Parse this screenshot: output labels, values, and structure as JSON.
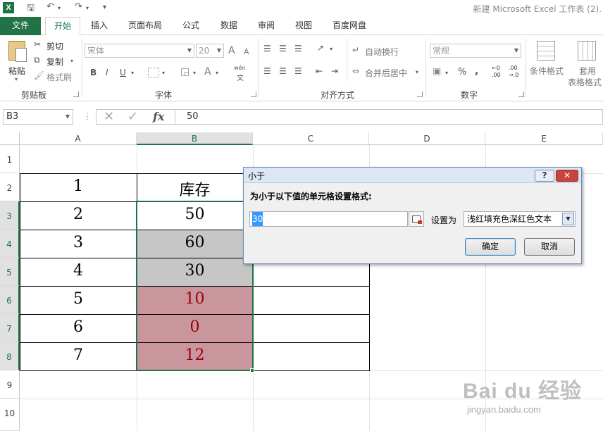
{
  "window": {
    "app_icon": "X",
    "title": "新建 Microsoft Excel 工作表 (2)."
  },
  "quick_access": {
    "save_icon": "save-icon",
    "undo_icon": "undo-icon",
    "redo_icon": "redo-icon",
    "customize_icon": "customize-icon"
  },
  "tabs": {
    "file": "文件",
    "home": "开始",
    "insert": "插入",
    "page_layout": "页面布局",
    "formulas": "公式",
    "data": "数据",
    "review": "审阅",
    "view": "视图",
    "baidu": "百度网盘"
  },
  "ribbon": {
    "clipboard": {
      "paste": "粘贴",
      "cut": "剪切",
      "copy": "复制",
      "format_painter": "格式刷",
      "group_label": "剪贴板"
    },
    "font": {
      "font_name": "宋体",
      "font_size": "20",
      "bold": "B",
      "italic": "I",
      "underline": "U",
      "grow": "A",
      "shrink": "A",
      "font_color": "A",
      "phonetic_top": "wén",
      "phonetic_bottom": "文",
      "group_label": "字体"
    },
    "alignment": {
      "wrap_text": "自动换行",
      "merge_center": "合并后居中",
      "group_label": "对齐方式"
    },
    "number": {
      "format": "常规",
      "percent": "%",
      "comma": ",",
      "inc_decimal_top": "←0",
      "inc_decimal_bottom": ".00",
      "dec_decimal_top": ".00",
      "dec_decimal_bottom": "→.0",
      "group_label": "数字"
    },
    "styles": {
      "conditional_format": "条件格式",
      "table_format_1": "套用",
      "table_format_2": "表格格式"
    }
  },
  "formula_bar": {
    "name_box": "B3",
    "fx": "fx",
    "value": "50"
  },
  "columns": [
    "A",
    "B",
    "C",
    "D",
    "E"
  ],
  "rows": [
    "1",
    "2",
    "3",
    "4",
    "5",
    "6",
    "7",
    "8",
    "9",
    "10"
  ],
  "cells": {
    "A2": "1",
    "B2": "库存",
    "A3": "2",
    "B3": "50",
    "A4": "3",
    "B4": "60",
    "A5": "4",
    "B5": "30",
    "A6": "5",
    "B6": "10",
    "A7": "6",
    "B7": "0",
    "A8": "7",
    "B8": "12"
  },
  "colors": {
    "accent": "#217346",
    "gray_fill": "#c6c6c6",
    "light_red_fill": "#c8969c",
    "dark_red_text": "#9c0006"
  },
  "dialog": {
    "title": "小于",
    "help": "?",
    "close": "✕",
    "prompt": "为小于以下值的单元格设置格式:",
    "input_value": "30",
    "set_as_label": "设置为",
    "format_option": "浅红填充色深红色文本",
    "ok": "确定",
    "cancel": "取消"
  },
  "watermark": {
    "line1": "Bai du 经验",
    "line2": "jingyan.baidu.com"
  }
}
